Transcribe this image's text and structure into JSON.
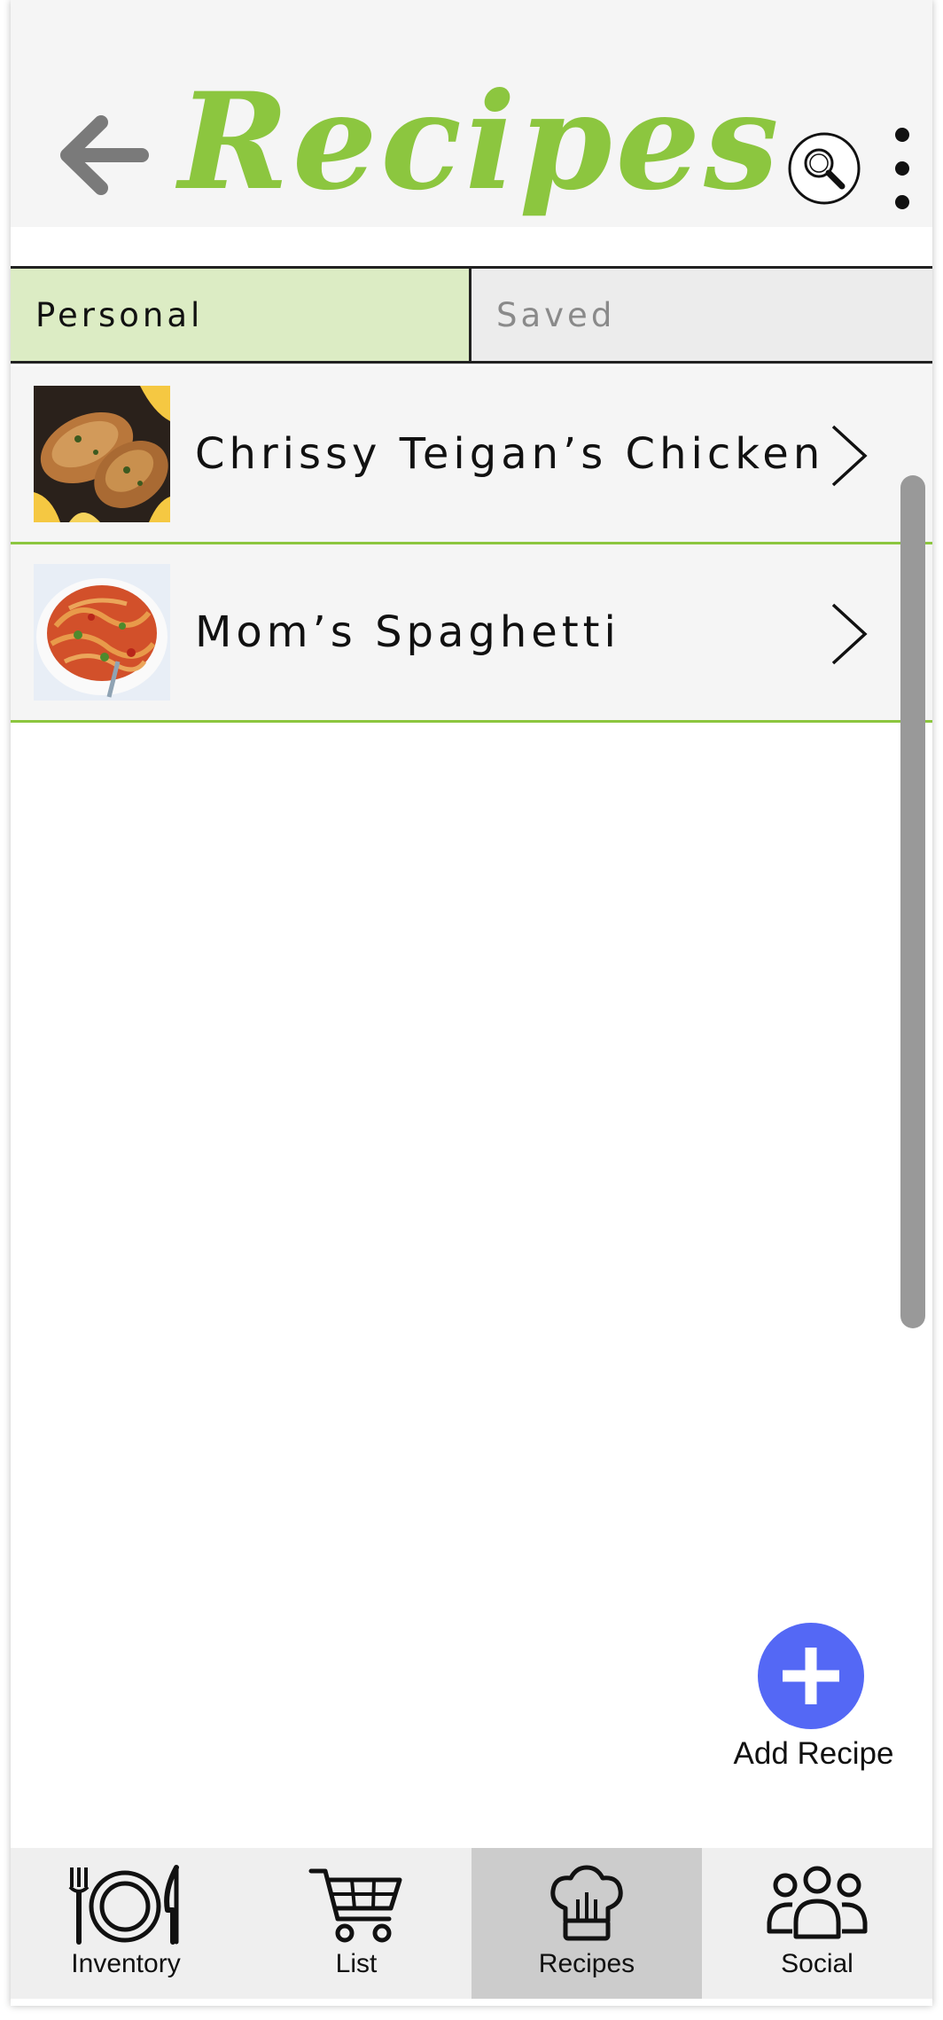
{
  "header": {
    "title": "Recipes",
    "title_color": "#8cc63f",
    "icons": [
      "back-arrow-icon",
      "search-icon",
      "more-vertical-icon"
    ]
  },
  "tabs": [
    {
      "label": "Personal",
      "selected": true
    },
    {
      "label": "Saved",
      "selected": false
    }
  ],
  "recipes": [
    {
      "name": "Chrissy Teigan’s Chicken",
      "thumbnail": "roast-chicken-photo"
    },
    {
      "name": "Mom’s Spaghetti",
      "thumbnail": "spaghetti-photo"
    }
  ],
  "fab": {
    "label": "Add Recipe",
    "icon": "plus-icon",
    "color": "#5468f5"
  },
  "bottom_nav": [
    {
      "label": "Inventory",
      "icon": "plate-utensils-icon",
      "active": false
    },
    {
      "label": "List",
      "icon": "shopping-cart-icon",
      "active": false
    },
    {
      "label": "Recipes",
      "icon": "chef-hat-icon",
      "active": true
    },
    {
      "label": "Social",
      "icon": "people-group-icon",
      "active": false
    }
  ],
  "colors": {
    "accent_green": "#8cc63f",
    "selected_tab": "#dcecc4",
    "active_nav": "#cccccc"
  }
}
